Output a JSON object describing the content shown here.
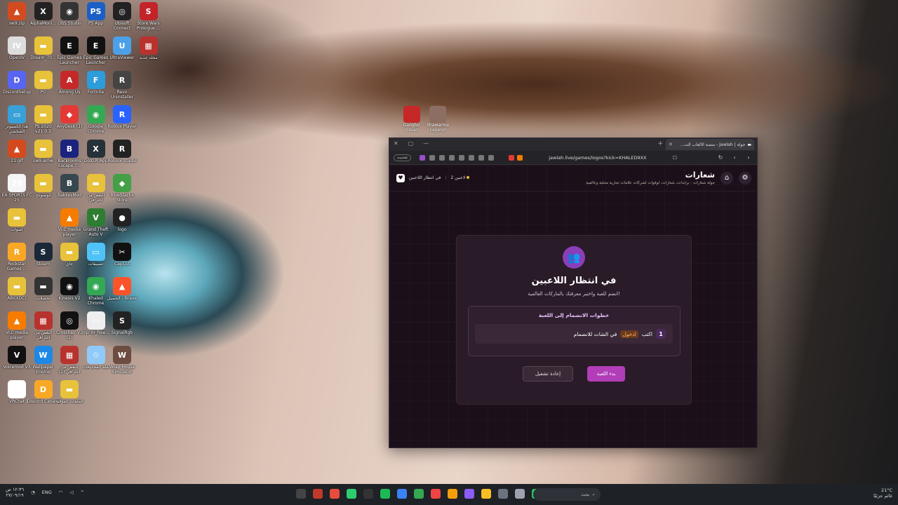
{
  "desktop": {
    "icons": [
      {
        "label": "sw9.zip",
        "color": "#d44a1f",
        "glyph": "▲",
        "col": 0,
        "row": 0
      },
      {
        "label": "AlphaMoni...",
        "color": "#222",
        "glyph": "X",
        "col": 1,
        "row": 0
      },
      {
        "label": "OBS Studio",
        "color": "#333",
        "glyph": "◉",
        "col": 2,
        "row": 0
      },
      {
        "label": "PS App",
        "color": "#1b5fc6",
        "glyph": "PS",
        "col": 3,
        "row": 0
      },
      {
        "label": "Ubisoft Connect",
        "color": "#222",
        "glyph": "◎",
        "col": 4,
        "row": 0
      },
      {
        "label": "Store Wars Prologue ...",
        "color": "#c3242a",
        "glyph": "S",
        "col": 5,
        "row": 0
      },
      {
        "label": "OpenIV",
        "color": "#ddd",
        "glyph": "IV",
        "col": 0,
        "row": 1
      },
      {
        "label": "Dream_70...",
        "color": "#e8c23a",
        "glyph": "▬",
        "col": 1,
        "row": 1
      },
      {
        "label": "Epic Games Launcher",
        "color": "#111",
        "glyph": "E",
        "col": 2,
        "row": 1
      },
      {
        "label": "Epic Games Launcher",
        "color": "#111",
        "glyph": "E",
        "col": 3,
        "row": 1
      },
      {
        "label": "UltraViewer",
        "color": "#4ca0e8",
        "glyph": "U",
        "col": 4,
        "row": 1
      },
      {
        "label": "مجلد جديد",
        "color": "#b8322e",
        "glyph": "▦",
        "col": 5,
        "row": 1
      },
      {
        "label": "DiscordSetup",
        "color": "#5865f2",
        "glyph": "D",
        "col": 0,
        "row": 2
      },
      {
        "label": "PC",
        "color": "#e8c23a",
        "glyph": "▬",
        "col": 1,
        "row": 2
      },
      {
        "label": "Among Us",
        "color": "#c62828",
        "glyph": "A",
        "col": 2,
        "row": 2
      },
      {
        "label": "Fortnite",
        "color": "#2d9cdb",
        "glyph": "F",
        "col": 3,
        "row": 2
      },
      {
        "label": "Revo Uninstaller",
        "color": "#444",
        "glyph": "R",
        "col": 4,
        "row": 2
      },
      {
        "label": "هذا الكمبيوتر الشخصي",
        "color": "#3aa0d8",
        "glyph": "▭",
        "col": 0,
        "row": 3
      },
      {
        "label": "PS 2020 v21.0.3",
        "color": "#e8c23a",
        "glyph": "▬",
        "col": 1,
        "row": 3
      },
      {
        "label": "AnyDesk (1)",
        "color": "#e53935",
        "glyph": "◆",
        "col": 2,
        "row": 3
      },
      {
        "label": "Google Chrome",
        "color": "#34a853",
        "glyph": "◉",
        "col": 3,
        "row": 3
      },
      {
        "label": "Roblox Player",
        "color": "#2962ff",
        "glyph": "R",
        "col": 4,
        "row": 3
      },
      {
        "label": "21.gif",
        "color": "#d44a1f",
        "glyph": "▲",
        "col": 0,
        "row": 4
      },
      {
        "label": "sw9-arnw",
        "color": "#e8c23a",
        "glyph": "▬",
        "col": 1,
        "row": 4
      },
      {
        "label": "Backrooms Escape T...",
        "color": "#1a237e",
        "glyph": "B",
        "col": 2,
        "row": 4
      },
      {
        "label": "GoXLR App",
        "color": "#263238",
        "glyph": "X",
        "col": 3,
        "row": 4
      },
      {
        "label": "Roblox Studio",
        "color": "#222",
        "glyph": "R",
        "col": 4,
        "row": 4
      },
      {
        "label": "EA SPORTS FC 25",
        "color": "#f5f5f5",
        "glyph": "25",
        "col": 0,
        "row": 5
      },
      {
        "label": "ابوصويلح",
        "color": "#e8c23a",
        "glyph": "▬",
        "col": 1,
        "row": 5
      },
      {
        "label": "BakkesMod",
        "color": "#37474f",
        "glyph": "B",
        "col": 2,
        "row": 5
      },
      {
        "label": "البعض من احترافي",
        "color": "#e8c23a",
        "glyph": "▬",
        "col": 3,
        "row": 5
      },
      {
        "label": "BlueStacks Store",
        "color": "#43a047",
        "glyph": "◆",
        "col": 4,
        "row": 5
      },
      {
        "label": "اصوات",
        "color": "#e8c23a",
        "glyph": "▬",
        "col": 0,
        "row": 6
      },
      {
        "label": "VLC media player",
        "color": "#f57c00",
        "glyph": "▲",
        "col": 2,
        "row": 6
      },
      {
        "label": "Grand Theft Auto V",
        "color": "#2e7d32",
        "glyph": "V",
        "col": 3,
        "row": 6
      },
      {
        "label": "logo",
        "color": "#222",
        "glyph": "●",
        "col": 4,
        "row": 6
      },
      {
        "label": "Rockstar Games ...",
        "color": "#f9a825",
        "glyph": "R",
        "col": 0,
        "row": 7
      },
      {
        "label": "Steam",
        "color": "#1b2838",
        "glyph": "S",
        "col": 1,
        "row": 7
      },
      {
        "label": "جاي",
        "color": "#e8c23a",
        "glyph": "▬",
        "col": 2,
        "row": 7
      },
      {
        "label": "تنسيقات",
        "color": "#4fc3f7",
        "glyph": "▭",
        "col": 3,
        "row": 7
      },
      {
        "label": "CapCut",
        "color": "#111",
        "glyph": "✂",
        "col": 4,
        "row": 7
      },
      {
        "label": "ABI(XDC)",
        "color": "#e8c23a",
        "glyph": "▬",
        "col": 0,
        "row": 8
      },
      {
        "label": "تحميلات",
        "color": "#333",
        "glyph": "▬",
        "col": 1,
        "row": 8
      },
      {
        "label": "Kinesis V2",
        "color": "#111",
        "glyph": "◉",
        "col": 2,
        "row": 8
      },
      {
        "label": "Khaled Chrome",
        "color": "#34a853",
        "glyph": "◉",
        "col": 3,
        "row": 8
      },
      {
        "label": "الحصيل - Brave",
        "color": "#fb542b",
        "glyph": "▲",
        "col": 4,
        "row": 8
      },
      {
        "label": "VLC media player",
        "color": "#f57c00",
        "glyph": "▲",
        "col": 0,
        "row": 9
      },
      {
        "label": "البعض من احترافي",
        "color": "#b8322e",
        "glyph": "▦",
        "col": 1,
        "row": 9
      },
      {
        "label": "Crosshair V2 (2)",
        "color": "#111",
        "glyph": "◎",
        "col": 2,
        "row": 9
      },
      {
        "label": "mp_m_free...",
        "color": "#eee",
        "glyph": "▭",
        "col": 3,
        "row": 9
      },
      {
        "label": "SignalRgb",
        "color": "#222",
        "glyph": "S",
        "col": 4,
        "row": 9
      },
      {
        "label": "Voicemod V3",
        "color": "#111",
        "glyph": "V",
        "col": 0,
        "row": 10
      },
      {
        "label": "Wallpaper Engine",
        "color": "#1e88e5",
        "glyph": "W",
        "col": 1,
        "row": 10
      },
      {
        "label": "البعض من احترافي (2)",
        "color": "#b8322e",
        "glyph": "▦",
        "col": 2,
        "row": 10
      },
      {
        "label": "سلة المحذوفات",
        "color": "#90caf9",
        "glyph": "♲",
        "col": 3,
        "row": 10
      },
      {
        "label": "Wrap House Simulator",
        "color": "#6d4c41",
        "glyph": "W",
        "col": 4,
        "row": 10
      },
      {
        "label": "VRChat",
        "color": "#fff",
        "glyph": "VR",
        "col": 0,
        "row": 11
      },
      {
        "label": "Discord Canary",
        "color": "#f9a825",
        "glyph": "D",
        "col": 1,
        "row": 11
      },
      {
        "label": "الملفات المؤقتة",
        "color": "#e8c23a",
        "glyph": "▬",
        "col": 2,
        "row": 11
      }
    ],
    "side_icons": [
      {
        "label": "Gangter Groan",
        "color": "#c62828"
      },
      {
        "label": "Shawarma Legend",
        "color": "#8d6e63"
      }
    ]
  },
  "browser": {
    "tab_title": "جولة | Jawlah - منصة الألعاب الت...",
    "update_label": "تحديث",
    "url": "jawlah.live/games/logos?kick=KHALED9XX"
  },
  "page": {
    "header": {
      "title": "شعارات",
      "subtitle": "جولة شعارات - براندات، شعارات، لوقوات لشركات علامات تجارية محلية وعالمية",
      "players_count": "2 لاعبين",
      "status": "في انتظار اللاعبين"
    },
    "card": {
      "title": "في انتظار اللاعبين",
      "subtitle": "انضم للعبة واختبر معرفتك بالماركات العالمية!",
      "steps_title": "خطوات الانضمام إلى اللعبة",
      "step_number": "1",
      "step_prefix": "اكتب",
      "step_keyword": "ادخول",
      "step_suffix": "في الشات للانضمام",
      "restart_label": "إعادة تشغيل",
      "start_label": "بدء اللعبة"
    }
  },
  "taskbar": {
    "time": "١٢:٣٦ ص",
    "date": "٢٧/٠٩/١٩",
    "lang": "ENG",
    "search_placeholder": "بحث",
    "temperature": "21°C",
    "weather": "غائم جزئيًا",
    "icon_colors": [
      "#444",
      "#c0392b",
      "#e74c3c",
      "#2ecc71",
      "#333",
      "#1db954",
      "#3b82f6",
      "#34a853",
      "#ef4444",
      "#f59e0b",
      "#8b5cf6",
      "#fbbf24",
      "#6b7280",
      "#9ca3af",
      "#22c55e"
    ]
  }
}
